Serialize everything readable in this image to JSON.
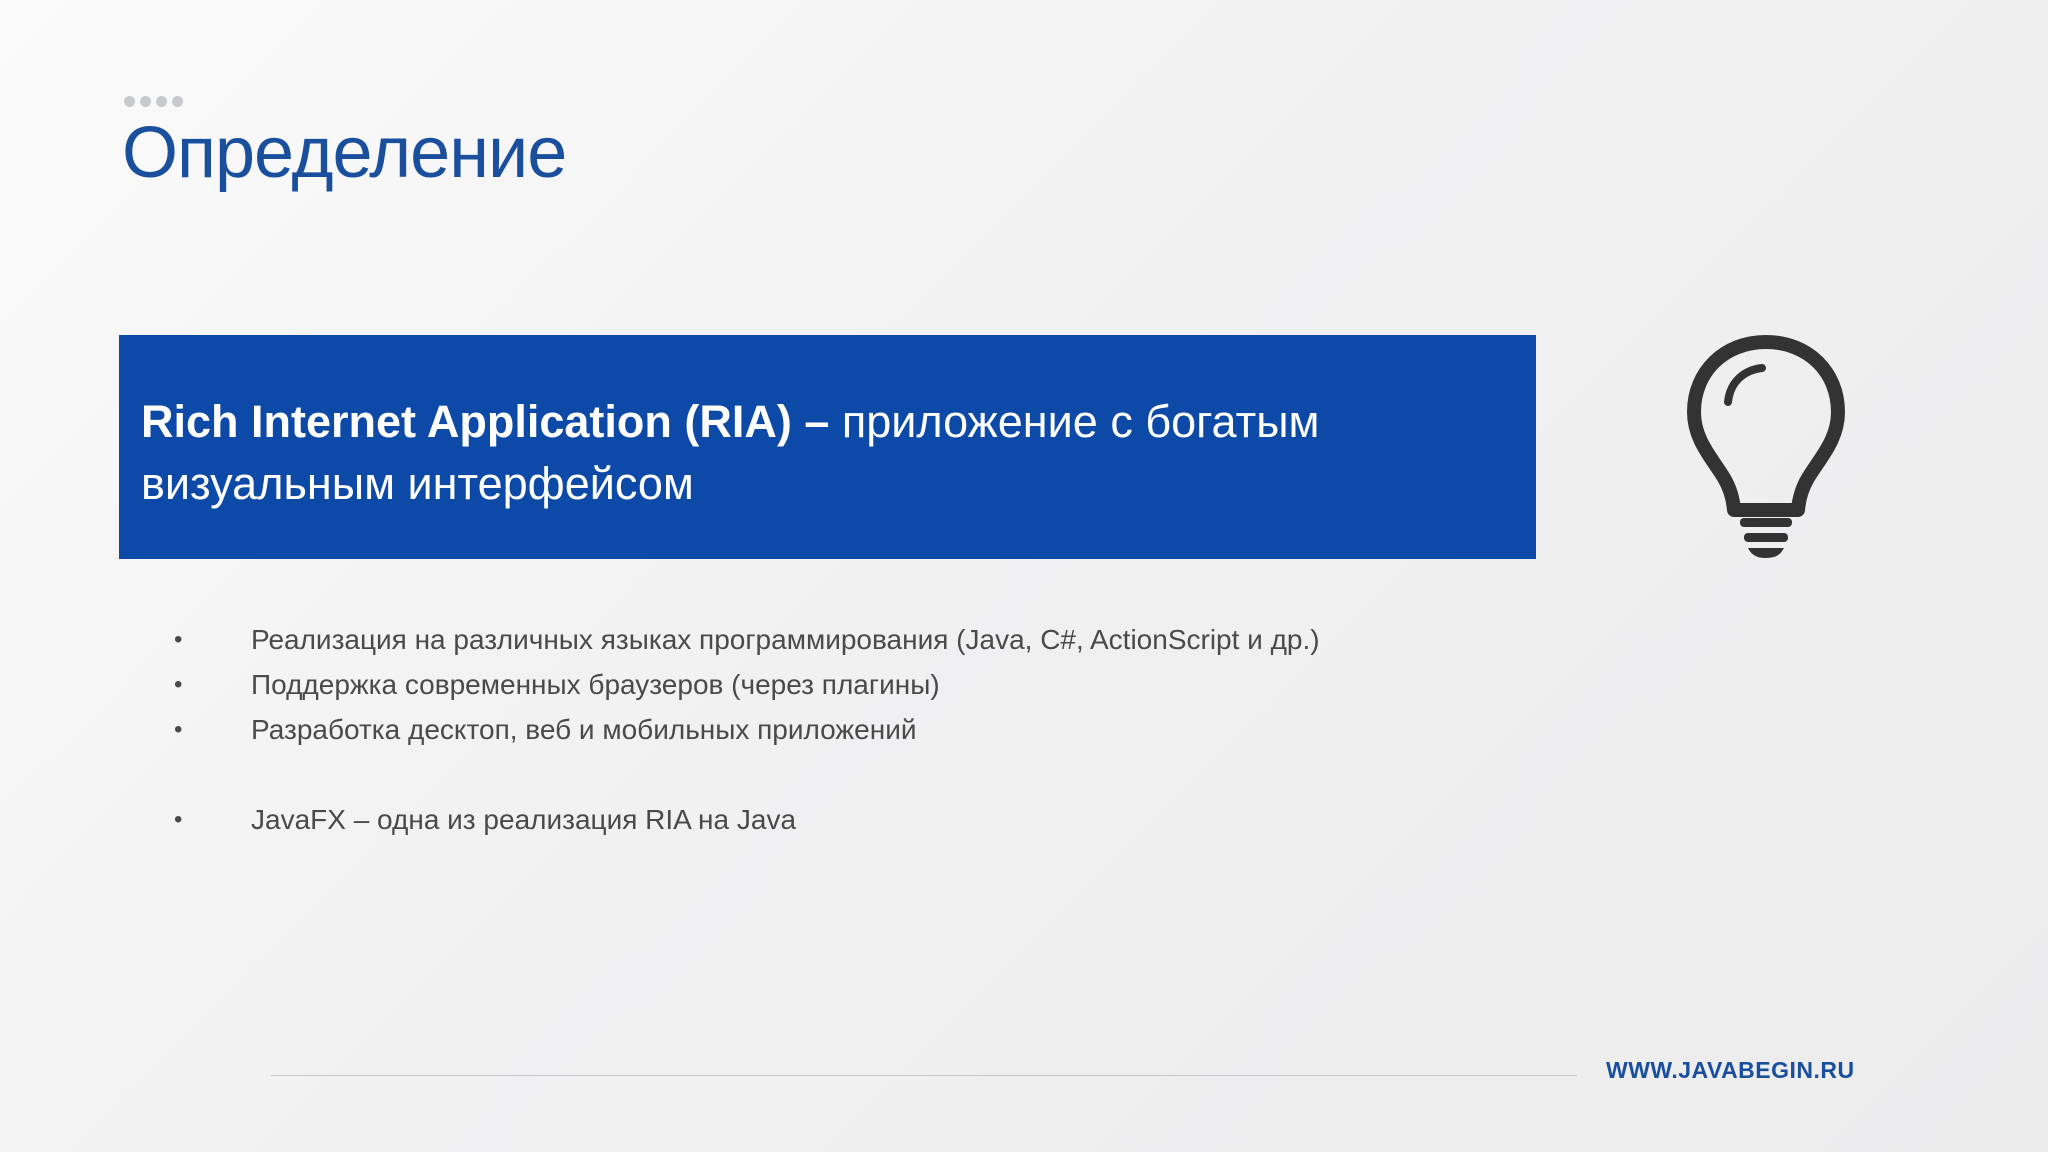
{
  "slide": {
    "title": "Определение",
    "definition": {
      "term": "Rich Internet Application (RIA) –",
      "text": " приложение с богатым визуальным интерфейсом"
    },
    "bullets": [
      {
        "text": "Реализация на различных языках программирования (Java, C#, ActionScript и др.)"
      },
      {
        "text": "Поддержка современных браузеров (через плагины)"
      },
      {
        "text": "Разработка десктоп, веб и мобильных приложений"
      },
      {
        "text": "JavaFX – одна из реализация RIA на Java"
      }
    ],
    "bullet_glyph": "•",
    "icon": "lightbulb-icon",
    "footer_url": "WWW.JAVABEGIN.RU"
  },
  "colors": {
    "accent": "#0d4aa8",
    "title": "#1a4f9e",
    "icon": "#333333",
    "body_text": "#4a4a4a"
  }
}
